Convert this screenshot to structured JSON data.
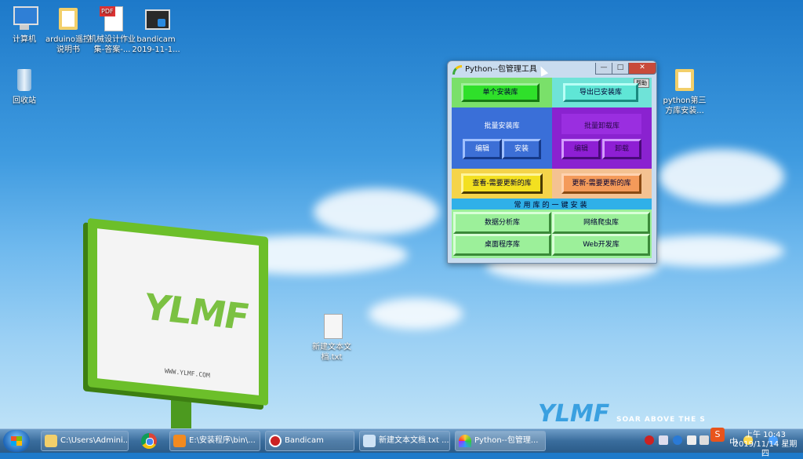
{
  "desktop": {
    "icons": [
      {
        "name": "computer-icon",
        "label": "计算机"
      },
      {
        "name": "folder-icon",
        "label": "arduino遥控说明书"
      },
      {
        "name": "pdf-icon",
        "label": "机械设计作业集-答案-..."
      },
      {
        "name": "bandicam-icon",
        "label": "bandicam 2019-11-1..."
      },
      {
        "name": "recycle-bin-icon",
        "label": "回收站"
      },
      {
        "name": "folder-icon",
        "label": "python第三方库安装..."
      },
      {
        "name": "text-file-icon",
        "label": "新建文本文档.txt"
      }
    ],
    "billboard_logo": "YLMF",
    "billboard_url": "WWW.YLMF.COM",
    "brand_logo": "YLMF",
    "brand_slogan": "SOAR ABOVE THE S",
    "pdf_badge": "PDF"
  },
  "window": {
    "title": "Python--包管理工具",
    "help_label": "帮助",
    "btn_minimize": "—",
    "btn_maximize": "□",
    "btn_close": "✕",
    "single_install": "单个安装库",
    "export_installed": "导出已安装库",
    "batch_install_label": "批量安装库",
    "batch_edit": "编辑",
    "batch_install": "安装",
    "batch_uninstall_label": "批量卸载库",
    "uninstall_edit": "编辑",
    "uninstall_do": "卸载",
    "view_updates": "查看-需要更新的库",
    "update_libs": "更新-需要更新的库",
    "common_label": "常用库的一键安装",
    "data_analysis": "数据分析库",
    "web_crawler": "网络爬虫库",
    "desktop_app": "桌面程序库",
    "web_dev": "Web开发库"
  },
  "taskbar": {
    "tasks": [
      {
        "label": "C:\\Users\\Admini..."
      },
      {
        "label": "E:\\安装程序\\bin\\..."
      },
      {
        "label": "Bandicam"
      },
      {
        "label": "新建文本文档.txt ..."
      },
      {
        "label": "Python--包管理..."
      }
    ],
    "tray_ime": "中",
    "clock_time": "上午 10:43",
    "clock_date": "2019/11/14 星期四"
  },
  "colors": {
    "green": "#7ae06a",
    "cyan": "#6fe3d8",
    "blue": "#3a6fd8",
    "purple": "#8a22d0",
    "yellow": "#f5d44a",
    "orange": "#f4c292",
    "sky": "#2fb0e8",
    "lightgreen": "#9cf09a"
  }
}
